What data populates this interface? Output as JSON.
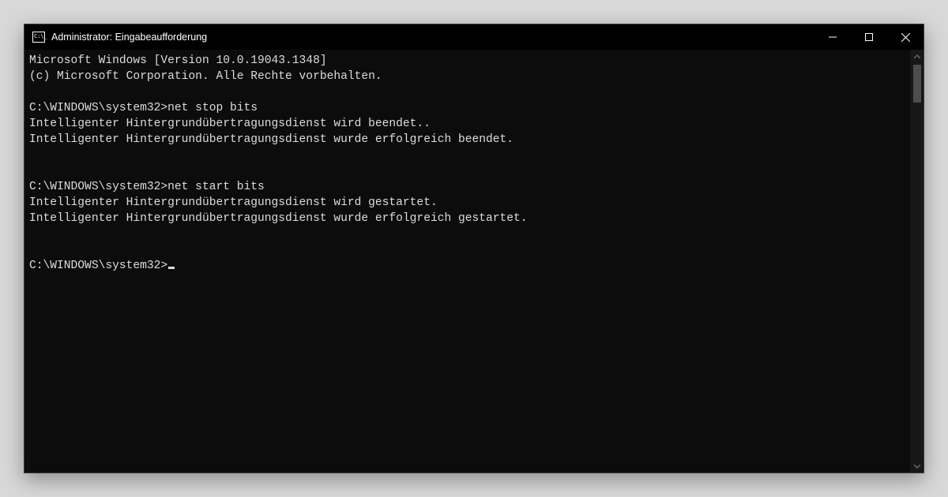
{
  "window": {
    "title": "Administrator: Eingabeaufforderung"
  },
  "terminal": {
    "lines": {
      "0": "Microsoft Windows [Version 10.0.19043.1348]",
      "1": "(c) Microsoft Corporation. Alle Rechte vorbehalten.",
      "2": "C:\\WINDOWS\\system32>net stop bits",
      "3": "Intelligenter Hintergrundübertragungsdienst wird beendet..",
      "4": "Intelligenter Hintergrundübertragungsdienst wurde erfolgreich beendet.",
      "5": "C:\\WINDOWS\\system32>net start bits",
      "6": "Intelligenter Hintergrundübertragungsdienst wird gestartet.",
      "7": "Intelligenter Hintergrundübertragungsdienst wurde erfolgreich gestartet.",
      "8": "C:\\WINDOWS\\system32>"
    }
  }
}
